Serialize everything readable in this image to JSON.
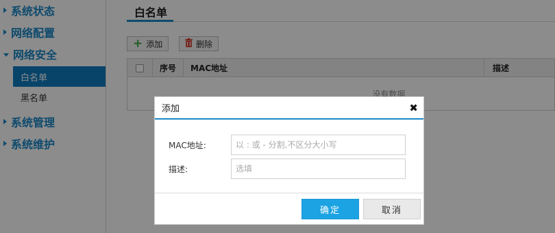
{
  "sidebar": {
    "groups": [
      {
        "label": "系统状态"
      },
      {
        "label": "网络配置"
      },
      {
        "label": "网络安全"
      },
      {
        "label": "系统管理"
      },
      {
        "label": "系统维护"
      }
    ],
    "sub_items": [
      {
        "label": "白名单",
        "active": true
      },
      {
        "label": "黑名单",
        "active": false
      }
    ]
  },
  "main": {
    "title": "白名单",
    "toolbar": {
      "add_label": "添加",
      "delete_label": "删除"
    },
    "table": {
      "columns": [
        "序号",
        "MAC地址",
        "描述"
      ],
      "empty_text": "没有数据"
    }
  },
  "modal": {
    "title": "添加",
    "close_glyph": "✖",
    "fields": {
      "mac": {
        "label": "MAC地址:",
        "placeholder": "以 : 或 - 分割,不区分大小写",
        "value": ""
      },
      "desc": {
        "label": "描述:",
        "placeholder": "选填",
        "value": ""
      }
    },
    "ok_label": "确定",
    "cancel_label": "取消"
  },
  "colors": {
    "accent": "#1a87c6",
    "active_nav": "#0f7cc0",
    "ok_button": "#1ca3e3"
  }
}
